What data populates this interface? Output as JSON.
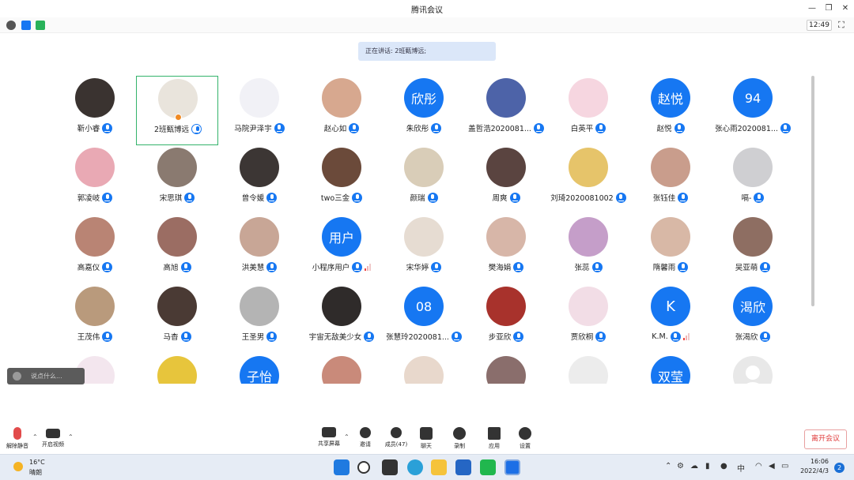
{
  "window": {
    "title": "腾讯会议"
  },
  "infobar": {
    "time": "12:49"
  },
  "speaking": {
    "text": "正在讲话: 2班甄博远;"
  },
  "colors": {
    "accent": "#1677f2",
    "selected": "#34b36b",
    "leave": "#e03c3c"
  },
  "participants": [
    {
      "name": "靳小睿",
      "avatar": {
        "type": "photo",
        "bg": "#3a3330"
      }
    },
    {
      "name": "2班甄博远",
      "avatar": {
        "type": "photo",
        "bg": "#e9e4dc"
      },
      "selected": true,
      "host": true,
      "mic": "outline"
    },
    {
      "name": "马院尹泽宇",
      "avatar": {
        "type": "photo",
        "bg": "#f1f1f6"
      }
    },
    {
      "name": "赵心如",
      "avatar": {
        "type": "photo",
        "bg": "#d7a88f"
      }
    },
    {
      "name": "朱欣彤",
      "avatar": {
        "type": "text",
        "text": "欣彤"
      }
    },
    {
      "name": "盖哲浩2020081...",
      "avatar": {
        "type": "photo",
        "bg": "#4d63a8"
      }
    },
    {
      "name": "白英平",
      "avatar": {
        "type": "photo",
        "bg": "#f6d6e0"
      }
    },
    {
      "name": "赵悦",
      "avatar": {
        "type": "text",
        "text": "赵悦"
      }
    },
    {
      "name": "张心雨2020081...",
      "avatar": {
        "type": "text",
        "text": "94"
      }
    },
    {
      "name": "郭凌岐",
      "avatar": {
        "type": "photo",
        "bg": "#e9a9b4"
      }
    },
    {
      "name": "宋思琪",
      "avatar": {
        "type": "photo",
        "bg": "#8a7a70"
      }
    },
    {
      "name": "曾令媛",
      "avatar": {
        "type": "photo",
        "bg": "#3c3634"
      }
    },
    {
      "name": "two三金",
      "avatar": {
        "type": "photo",
        "bg": "#6b4a3a"
      }
    },
    {
      "name": "颜瑞",
      "avatar": {
        "type": "photo",
        "bg": "#d9cdb8"
      }
    },
    {
      "name": "周爽",
      "avatar": {
        "type": "photo",
        "bg": "#5a4440"
      }
    },
    {
      "name": "刘琦2020081002",
      "avatar": {
        "type": "photo",
        "bg": "#e6c46a"
      }
    },
    {
      "name": "张钰佳",
      "avatar": {
        "type": "photo",
        "bg": "#c99d8c"
      }
    },
    {
      "name": "嗝-",
      "avatar": {
        "type": "photo",
        "bg": "#cfcfd2"
      }
    },
    {
      "name": "高嘉仪",
      "avatar": {
        "type": "photo",
        "bg": "#b98474"
      }
    },
    {
      "name": "高旭",
      "avatar": {
        "type": "photo",
        "bg": "#9b6d63"
      }
    },
    {
      "name": "洪美慧",
      "avatar": {
        "type": "photo",
        "bg": "#c8a696"
      }
    },
    {
      "name": "小程序用户",
      "avatar": {
        "type": "text",
        "text": "用户"
      },
      "signal": true
    },
    {
      "name": "宋华婷",
      "avatar": {
        "type": "photo",
        "bg": "#e6dcd2"
      }
    },
    {
      "name": "樊海娟",
      "avatar": {
        "type": "photo",
        "bg": "#d7b6a8"
      }
    },
    {
      "name": "张蕊",
      "avatar": {
        "type": "photo",
        "bg": "#c59ec9"
      }
    },
    {
      "name": "隋馨雨",
      "avatar": {
        "type": "photo",
        "bg": "#d8b8a6"
      }
    },
    {
      "name": "吴亚萌",
      "avatar": {
        "type": "photo",
        "bg": "#8e6e62"
      }
    },
    {
      "name": "王茂伟",
      "avatar": {
        "type": "photo",
        "bg": "#b99a7c"
      }
    },
    {
      "name": "马杳",
      "avatar": {
        "type": "photo",
        "bg": "#4a3a34"
      }
    },
    {
      "name": "王圣男",
      "avatar": {
        "type": "photo",
        "bg": "#b4b4b4"
      }
    },
    {
      "name": "宇宙无敌美少女",
      "avatar": {
        "type": "photo",
        "bg": "#2f2b2a"
      }
    },
    {
      "name": "张慧玲2020081...",
      "avatar": {
        "type": "text",
        "text": "08"
      }
    },
    {
      "name": "步亚欣",
      "avatar": {
        "type": "photo",
        "bg": "#a8322c"
      }
    },
    {
      "name": "贾欣桐",
      "avatar": {
        "type": "photo",
        "bg": "#f2dde6"
      }
    },
    {
      "name": "K.M.",
      "avatar": {
        "type": "text",
        "text": "K"
      },
      "signal": true
    },
    {
      "name": "张渴欣",
      "avatar": {
        "type": "text",
        "text": "渴欣"
      }
    },
    {
      "name": "",
      "avatar": {
        "type": "photo",
        "bg": "#f3e6ee"
      }
    },
    {
      "name": "",
      "avatar": {
        "type": "photo",
        "bg": "#e7c53c"
      }
    },
    {
      "name": "",
      "avatar": {
        "type": "text",
        "text": "子怡"
      }
    },
    {
      "name": "",
      "avatar": {
        "type": "photo",
        "bg": "#c98a7a"
      }
    },
    {
      "name": "",
      "avatar": {
        "type": "photo",
        "bg": "#e8d8cc"
      }
    },
    {
      "name": "",
      "avatar": {
        "type": "photo",
        "bg": "#8a6e6c"
      }
    },
    {
      "name": "",
      "avatar": {
        "type": "photo",
        "bg": "#ececec"
      }
    },
    {
      "name": "",
      "avatar": {
        "type": "text",
        "text": "双莹"
      }
    },
    {
      "name": "",
      "avatar": {
        "type": "placeholder"
      }
    }
  ],
  "chat": {
    "placeholder": "说点什么..."
  },
  "toolbar": {
    "unmute": "解除静音",
    "video": "开启视频",
    "share": "共享屏幕",
    "invite": "邀请",
    "members": "成员(47)",
    "chat": "聊天",
    "record": "录制",
    "apps": "应用",
    "settings": "设置",
    "leave": "离开会议"
  },
  "taskbar": {
    "temperature": "16°C",
    "weather": "晴朗",
    "ime": "中",
    "time": "16:06",
    "date": "2022/4/3",
    "notifications": "2"
  }
}
